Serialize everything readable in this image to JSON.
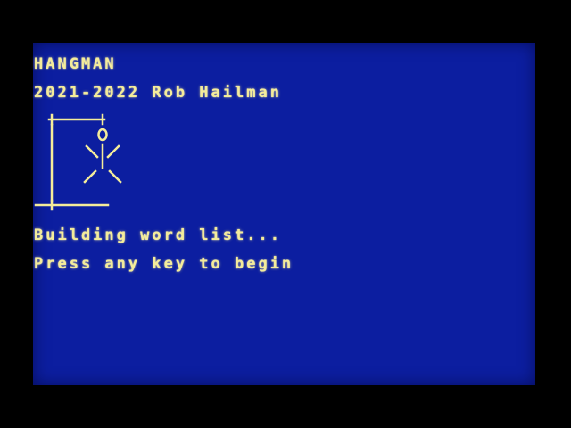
{
  "screen": {
    "background_color": "#0c1ea0",
    "text_color": "#f4ec9a"
  },
  "title": "HANGMAN",
  "credit": "2021-2022 Rob Hailman",
  "status": "Building word list...",
  "prompt": "Press any key to begin",
  "gallows": {
    "art_parts": [
      "gallows",
      "rope",
      "head",
      "body",
      "left-arm",
      "right-arm",
      "left-leg",
      "right-leg"
    ]
  }
}
